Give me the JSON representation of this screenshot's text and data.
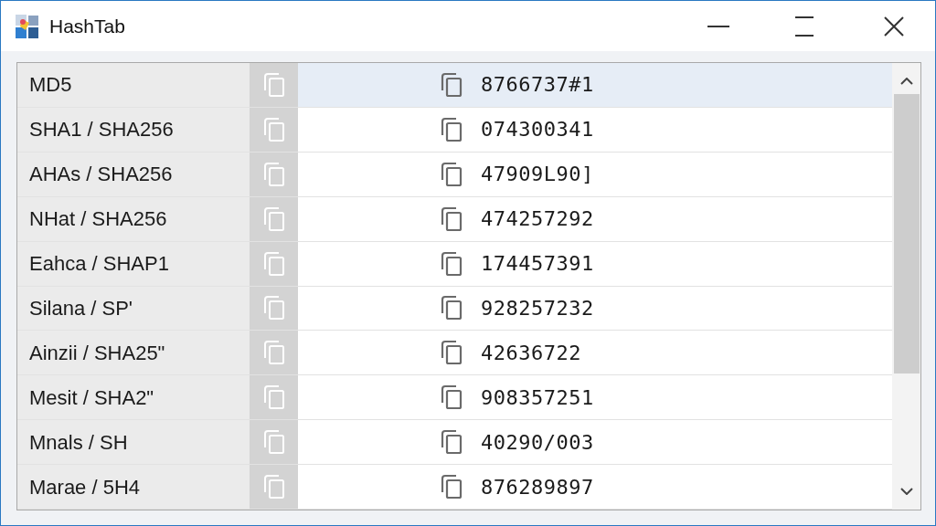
{
  "window": {
    "title": "HashTab"
  },
  "rows": [
    {
      "name": "MD5",
      "hash": "8766737#1",
      "selected": true
    },
    {
      "name": "SHA1 / SHA256",
      "hash": "074300341",
      "selected": false
    },
    {
      "name": "AHAs / SHA256",
      "hash": "47909L90]",
      "selected": false
    },
    {
      "name": "NHat / SHA256",
      "hash": "474257292",
      "selected": false
    },
    {
      "name": "Eahca / SHAP1",
      "hash": "174457391",
      "selected": false
    },
    {
      "name": "Silana / SP'",
      "hash": "928257232",
      "selected": false
    },
    {
      "name": "Ainzii / SHA25\"",
      "hash": "42636722",
      "selected": false
    },
    {
      "name": "Mesit / SHA2\"",
      "hash": "908357251",
      "selected": false
    },
    {
      "name": "Mnals / SH",
      "hash": "40290/003",
      "selected": false
    },
    {
      "name": "Marae / 5H4",
      "hash": "876289897",
      "selected": false
    }
  ]
}
